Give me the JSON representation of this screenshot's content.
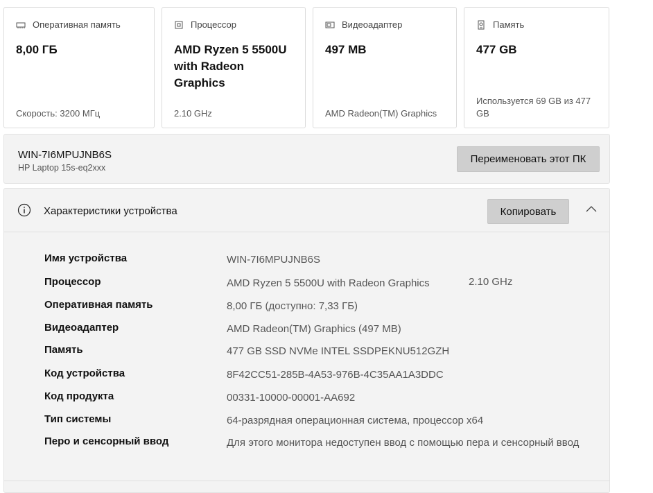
{
  "cards": [
    {
      "icon": "ram-icon",
      "title": "Оперативная память",
      "value": "8,00 ГБ",
      "sub": "Скорость: 3200 МГц"
    },
    {
      "icon": "processor-icon",
      "title": "Процессор",
      "value": "AMD Ryzen 5 5500U with Radeon Graphics",
      "sub": "2.10 GHz"
    },
    {
      "icon": "gpu-icon",
      "title": "Видеоадаптер",
      "value": "497 MB",
      "sub": "AMD Radeon(TM) Graphics"
    },
    {
      "icon": "storage-icon",
      "title": "Память",
      "value": "477 GB",
      "sub": "Используется 69 GB из 477 GB"
    }
  ],
  "pc": {
    "name": "WIN-7I6MPUJNB6S",
    "model": "HP Laptop 15s-eq2xxx",
    "rename_label": "Переименовать этот ПК"
  },
  "specs": {
    "title": "Характеристики устройства",
    "copy_label": "Копировать",
    "rows": [
      {
        "label": "Имя устройства",
        "value": "WIN-7I6MPUJNB6S"
      },
      {
        "label": "Процессор",
        "value": "AMD Ryzen 5 5500U with Radeon Graphics",
        "extra": "2.10 GHz"
      },
      {
        "label": "Оперативная память",
        "value": "8,00 ГБ (доступно: 7,33 ГБ)"
      },
      {
        "label": "Видеоадаптер",
        "value": "AMD Radeon(TM) Graphics (497 MB)"
      },
      {
        "label": "Память",
        "value": "477 GB SSD NVMe INTEL SSDPEKNU512GZH"
      },
      {
        "label": "Код устройства",
        "value": "8F42CC51-285B-4A53-976B-4C35AA1A3DDC"
      },
      {
        "label": "Код продукта",
        "value": "00331-10000-00001-AA692"
      },
      {
        "label": "Тип системы",
        "value": "64-разрядная операционная система, процессор x64"
      },
      {
        "label": "Перо и сенсорный ввод",
        "value": "Для этого монитора недоступен ввод с помощью пера и сенсорный ввод"
      }
    ]
  }
}
